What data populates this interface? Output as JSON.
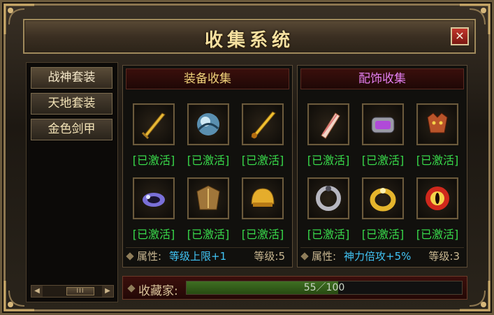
{
  "window": {
    "title": "收集系统",
    "close_label": "✕"
  },
  "sidebar": {
    "items": [
      {
        "label": "战神套装"
      },
      {
        "label": "天地套装"
      },
      {
        "label": "金色剑甲"
      }
    ],
    "scroll_thumb": "III",
    "scroll_left": "◀",
    "scroll_right": "▶"
  },
  "equipment": {
    "header": "装备收集",
    "items": [
      {
        "icon": "gold-sword-icon",
        "status": "[已激活]"
      },
      {
        "icon": "blue-orb-icon",
        "status": "[已激活]"
      },
      {
        "icon": "gold-blade-icon",
        "status": "[已激活]"
      },
      {
        "icon": "purple-bracelet-icon",
        "status": "[已激活]"
      },
      {
        "icon": "bronze-armor-icon",
        "status": "[已激活]"
      },
      {
        "icon": "gold-helmet-icon",
        "status": "[已激活]"
      }
    ],
    "attr_label": "属性:",
    "attr_value": "等级上限+1",
    "level_text": "等级:5"
  },
  "accessories": {
    "header": "配饰收集",
    "items": [
      {
        "icon": "scroll-icon",
        "status": "[已激活]"
      },
      {
        "icon": "silver-bracelet-icon",
        "status": "[已激活]"
      },
      {
        "icon": "demon-mask-icon",
        "status": "[已激活]"
      },
      {
        "icon": "silver-ring-icon",
        "status": "[已激活]"
      },
      {
        "icon": "gold-ring-icon",
        "status": "[已激活]"
      },
      {
        "icon": "red-eye-icon",
        "status": "[已激活]"
      }
    ],
    "attr_label": "属性:",
    "attr_value": "神力倍攻+5%",
    "level_text": "等级:3"
  },
  "collector": {
    "label": "收藏家:",
    "progress_text": "55／100",
    "progress_fraction": 0.55
  },
  "colors": {
    "active_status": "#38d84a",
    "attr_value": "#41c4f5",
    "equipment_header": "#f0d27a",
    "accessories_header": "#e27ef0"
  }
}
